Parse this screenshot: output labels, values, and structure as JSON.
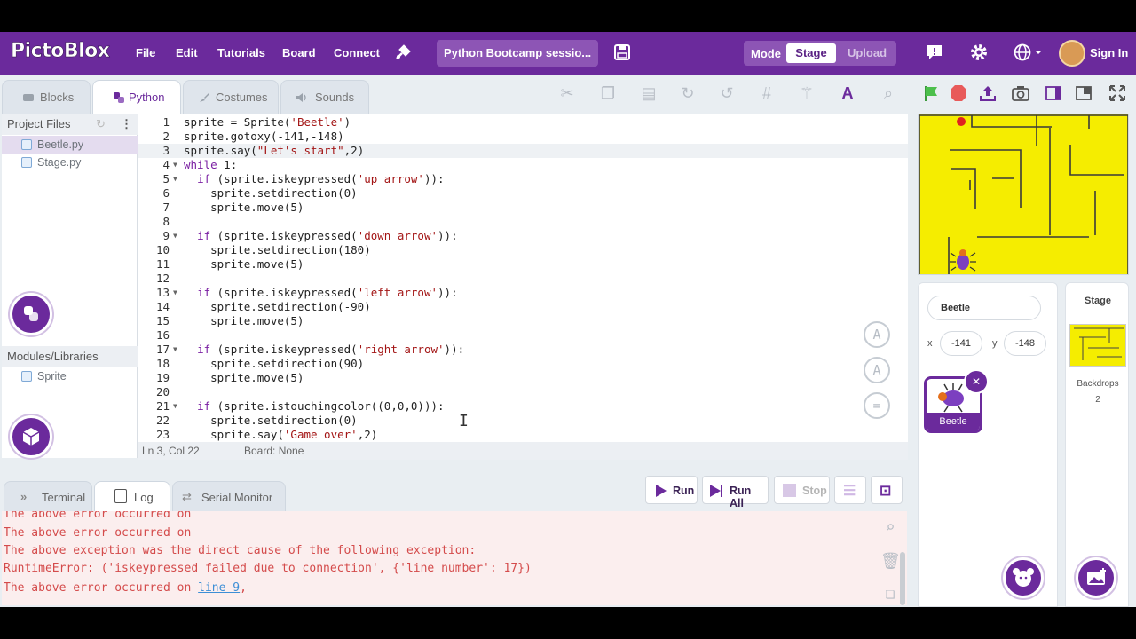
{
  "brand": "PictoBlox",
  "menu": {
    "file": "File",
    "edit": "Edit",
    "tutorials": "Tutorials",
    "board": "Board",
    "connect": "Connect"
  },
  "project_title": "Python Bootcamp sessio...",
  "mode": {
    "label": "Mode",
    "stage": "Stage",
    "upload": "Upload"
  },
  "sign_in": "Sign In",
  "tabs": {
    "blocks": "Blocks",
    "python": "Python",
    "costumes": "Costumes",
    "sounds": "Sounds"
  },
  "project_files": {
    "header": "Project Files",
    "files": [
      "Beetle.py",
      "Stage.py"
    ]
  },
  "modules": {
    "header": "Modules/Libraries",
    "items": [
      "Sprite"
    ]
  },
  "code_lines": [
    "sprite = Sprite('Beetle')",
    "sprite.gotoxy(-141,-148)",
    "sprite.say(\"Let's start\",2)",
    "while 1:",
    "  if (sprite.iskeypressed('up arrow')):",
    "    sprite.setdirection(0)",
    "    sprite.move(5)",
    "",
    "  if (sprite.iskeypressed('down arrow')):",
    "    sprite.setdirection(180)",
    "    sprite.move(5)",
    "",
    "  if (sprite.iskeypressed('left arrow')):",
    "    sprite.setdirection(-90)",
    "    sprite.move(5)",
    "",
    "  if (sprite.iskeypressed('right arrow')):",
    "    sprite.setdirection(90)",
    "    sprite.move(5)",
    "",
    "  if (sprite.istouchingcolor((0,0,0))):",
    "    sprite.setdirection(0)",
    "    sprite.say('Game over',2)"
  ],
  "line_numbers": [
    "1",
    "2",
    "3",
    "4",
    "5",
    "6",
    "7",
    "8",
    "9",
    "10",
    "11",
    "12",
    "13",
    "14",
    "15",
    "16",
    "17",
    "18",
    "19",
    "20",
    "21",
    "22",
    "23"
  ],
  "status": {
    "cursor": "Ln 3, Col 22",
    "board": "Board: None"
  },
  "bottom_tabs": {
    "terminal": "Terminal",
    "log": "Log",
    "serial": "Serial Monitor"
  },
  "buttons": {
    "run": "Run",
    "run_all": "Run All",
    "stop": "Stop"
  },
  "console": {
    "lines": [
      "The above error occurred on",
      "The above error occurred on",
      "The above exception was the direct cause of the following exception:",
      "RuntimeError: ('iskeypressed failed due to connection', {'line number': 17})"
    ],
    "last_prefix": "The above error occurred on ",
    "last_link": "line 9",
    "last_suffix": ","
  },
  "sprite": {
    "name": "Beetle",
    "x_label": "x",
    "x": "-141",
    "y_label": "y",
    "y": "-148"
  },
  "stage_panel": {
    "title": "Stage",
    "backdrops_label": "Backdrops",
    "backdrops_count": "2"
  },
  "colors": {
    "brand": "#6b2a9c",
    "stage_bg": "#f5ed00",
    "error": "#d44b4b"
  }
}
